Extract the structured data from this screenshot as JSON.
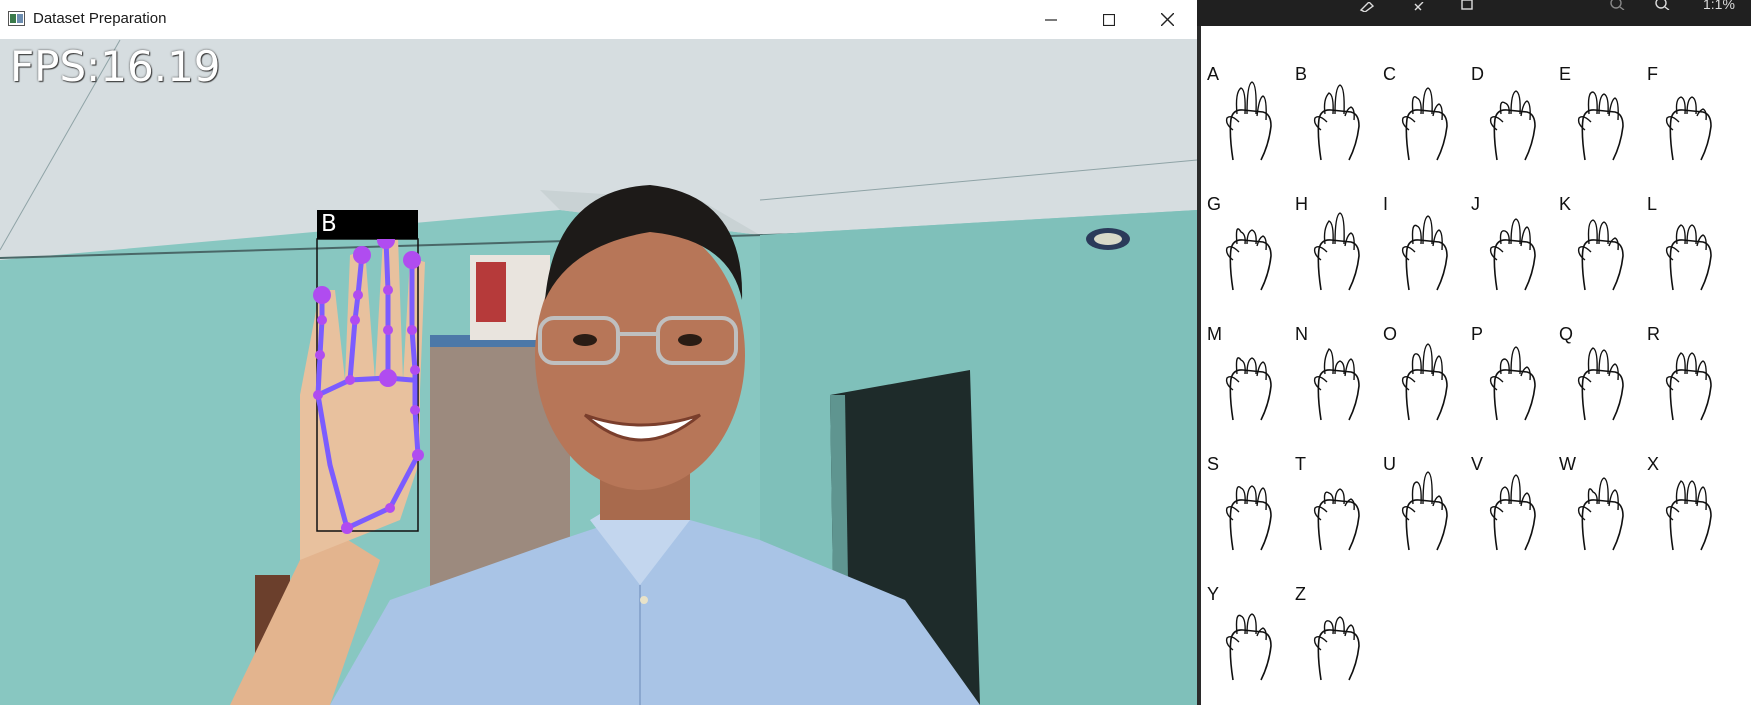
{
  "window": {
    "title": "Dataset Preparation",
    "controls": {
      "minimize": "minimize-icon",
      "maximize": "maximize-icon",
      "close": "close-icon"
    }
  },
  "video": {
    "fps_text": "FPS:16.19",
    "detection_label": "B",
    "landmark_color": "#b04cf0",
    "connection_color": "#7b5cff"
  },
  "panel": {
    "toolbar_icons": [
      "edit-icon",
      "rotate-icon",
      "delete-icon",
      "zoom-out-icon",
      "zoom-in-icon"
    ],
    "zoom_text": "1:1%"
  },
  "alphabet_chart": {
    "letters": [
      "A",
      "B",
      "C",
      "D",
      "E",
      "F",
      "G",
      "H",
      "I",
      "J",
      "K",
      "L",
      "M",
      "N",
      "O",
      "P",
      "Q",
      "R",
      "S",
      "T",
      "U",
      "V",
      "W",
      "X",
      "Y",
      "Z"
    ]
  }
}
